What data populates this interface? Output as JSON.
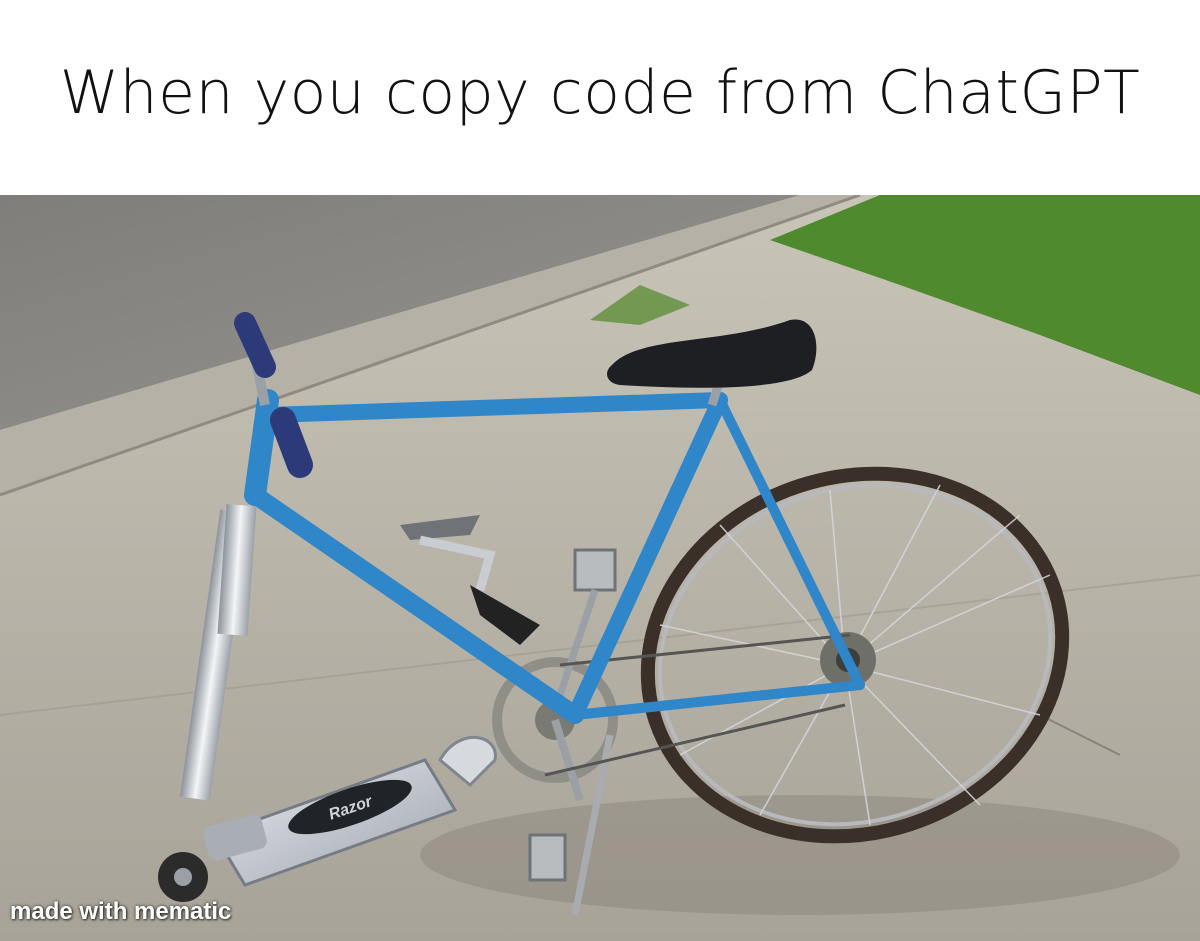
{
  "meme": {
    "caption": "When you copy code from ChatGPT",
    "watermark": "made with mematic"
  },
  "photo": {
    "scooter_brand": "Razor",
    "colors": {
      "bike_frame": "#2f86c8",
      "sidewalk": "#bdb8ad",
      "road": "#8a8986",
      "grass": "#4f8a2e"
    }
  }
}
